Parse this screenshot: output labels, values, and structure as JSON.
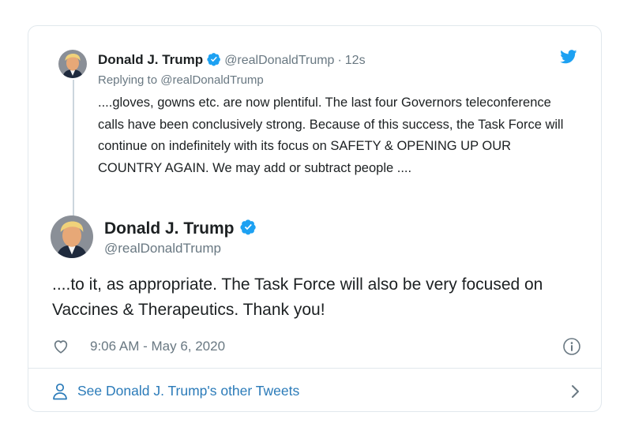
{
  "reply_tweet": {
    "name": "Donald J. Trump",
    "handle": "@realDonaldTrump",
    "separator": "·",
    "time_ago": "12s",
    "replying_prefix": "Replying to",
    "replying_to": "@realDonaldTrump",
    "text": "....gloves, gowns etc. are now plentiful. The last four Governors teleconference calls have been conclusively strong. Because of this success, the Task Force will continue on indefinitely with its focus on SAFETY & OPENING UP OUR COUNTRY AGAIN. We may add or subtract people ...."
  },
  "main_tweet": {
    "name": "Donald J. Trump",
    "handle": "@realDonaldTrump",
    "text": "....to it, as appropriate. The Task Force will also be very focused on Vaccines & Therapeutics. Thank you!",
    "timestamp": "9:06 AM - May 6, 2020"
  },
  "footer": {
    "label": "See Donald J. Trump's other Tweets"
  },
  "icons": {
    "logo": "twitter-bird-icon",
    "verified": "verified-badge-icon",
    "like": "heart-icon",
    "info": "info-icon",
    "profile": "person-icon",
    "more": "chevron-right-icon"
  },
  "colors": {
    "brand_blue": "#1da1f2",
    "link_blue": "#2b7bb9",
    "muted_text": "#697882",
    "border": "#e1e8ed"
  }
}
